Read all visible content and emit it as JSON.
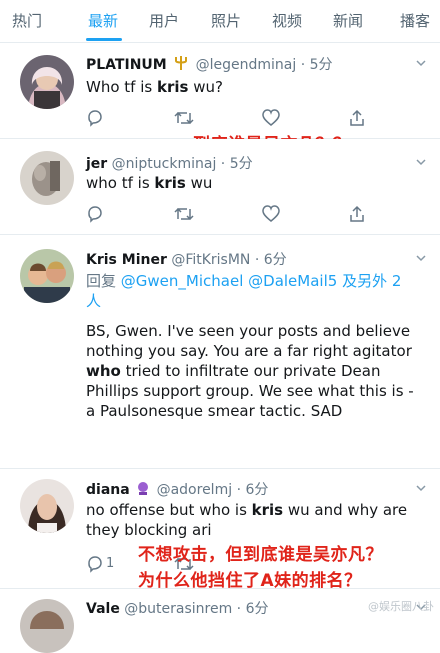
{
  "tabs": [
    {
      "label": "热门"
    },
    {
      "label": "最新",
      "active": true
    },
    {
      "label": "用户"
    },
    {
      "label": "照片"
    },
    {
      "label": "视频"
    },
    {
      "label": "新闻"
    },
    {
      "label": "播客"
    }
  ],
  "tweets": [
    {
      "name": "PLATINUM",
      "handle": "@legendminaj",
      "time": "· 5分",
      "text_before": "Who tf is ",
      "text_bold": "kris",
      "text_after": " wu?"
    },
    {
      "name": "jer",
      "handle": "@niptuckminaj",
      "time": "· 5分",
      "text_before": "who tf is ",
      "text_bold": "kris",
      "text_after": " wu"
    },
    {
      "name": "Kris  Miner",
      "handle": "@FitKrisMN",
      "time": "· 6分",
      "reply_prefix": "回复 ",
      "reply_mention_1": "@Gwen_Michael",
      "reply_mention_2": "@DaleMail5",
      "reply_suffix": " 及另外 2",
      "reply_suffix_2": "人",
      "text_1": "BS, Gwen. I've seen your posts and believe nothing you say. You are a far right agitator ",
      "text_bold": "who",
      "text_2": " tried to infiltrate our private Dean Phillips support group. We see what this is - a Paulsonesque smear tactic. SAD"
    },
    {
      "name": "diana",
      "handle": "@adorelmj",
      "time": "· 6分",
      "text_before": "no offense but who is ",
      "text_bold": "kris",
      "text_after": " wu and why are they blocking ari",
      "reply_count": "1"
    },
    {
      "name": "Vale",
      "handle": "@buterasinrem",
      "time": "· 6分"
    }
  ],
  "annotations": {
    "first": "到底谁是吴亦凡？？",
    "second_line1": "不想攻击，但到底谁是吴亦凡？",
    "second_line2": "为什么他挡住了A妹的排名？"
  },
  "watermark": "@娱乐圈八卦",
  "colors": {
    "accent": "#1da1f2",
    "annotation": "#e0241a",
    "secondary_text": "#657786"
  }
}
